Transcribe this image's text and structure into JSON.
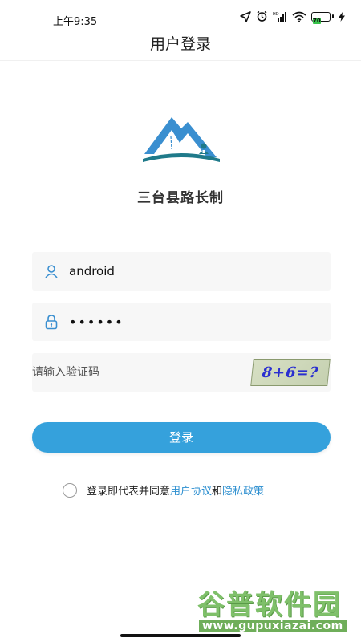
{
  "status_bar": {
    "time": "上午9:35",
    "battery_level": "70",
    "icons": [
      "location-arrow-icon",
      "alarm-icon",
      "signal-icon",
      "wifi-icon",
      "battery-icon",
      "charging-icon"
    ]
  },
  "header": {
    "title": "用户登录"
  },
  "app": {
    "name": "三台县路长制"
  },
  "form": {
    "username": {
      "value": "android",
      "icon": "user-icon"
    },
    "password": {
      "value": "••••••",
      "icon": "lock-icon"
    },
    "captcha": {
      "value": "",
      "placeholder": "请输入验证码",
      "image_text": "8+6=?"
    },
    "submit_label": "登录"
  },
  "agreement": {
    "checked": false,
    "prefix": "登录即代表并同意",
    "user_agreement": "用户协议",
    "conjunction": "和",
    "privacy_policy": "隐私政策"
  },
  "watermark": {
    "main": "谷普软件园",
    "url": "www.gupuxiazai.com"
  },
  "colors": {
    "accent": "#35a1dc",
    "link": "#2d8fd0",
    "logo_blue": "#3a8fd0",
    "logo_teal": "#1f7a8a"
  }
}
